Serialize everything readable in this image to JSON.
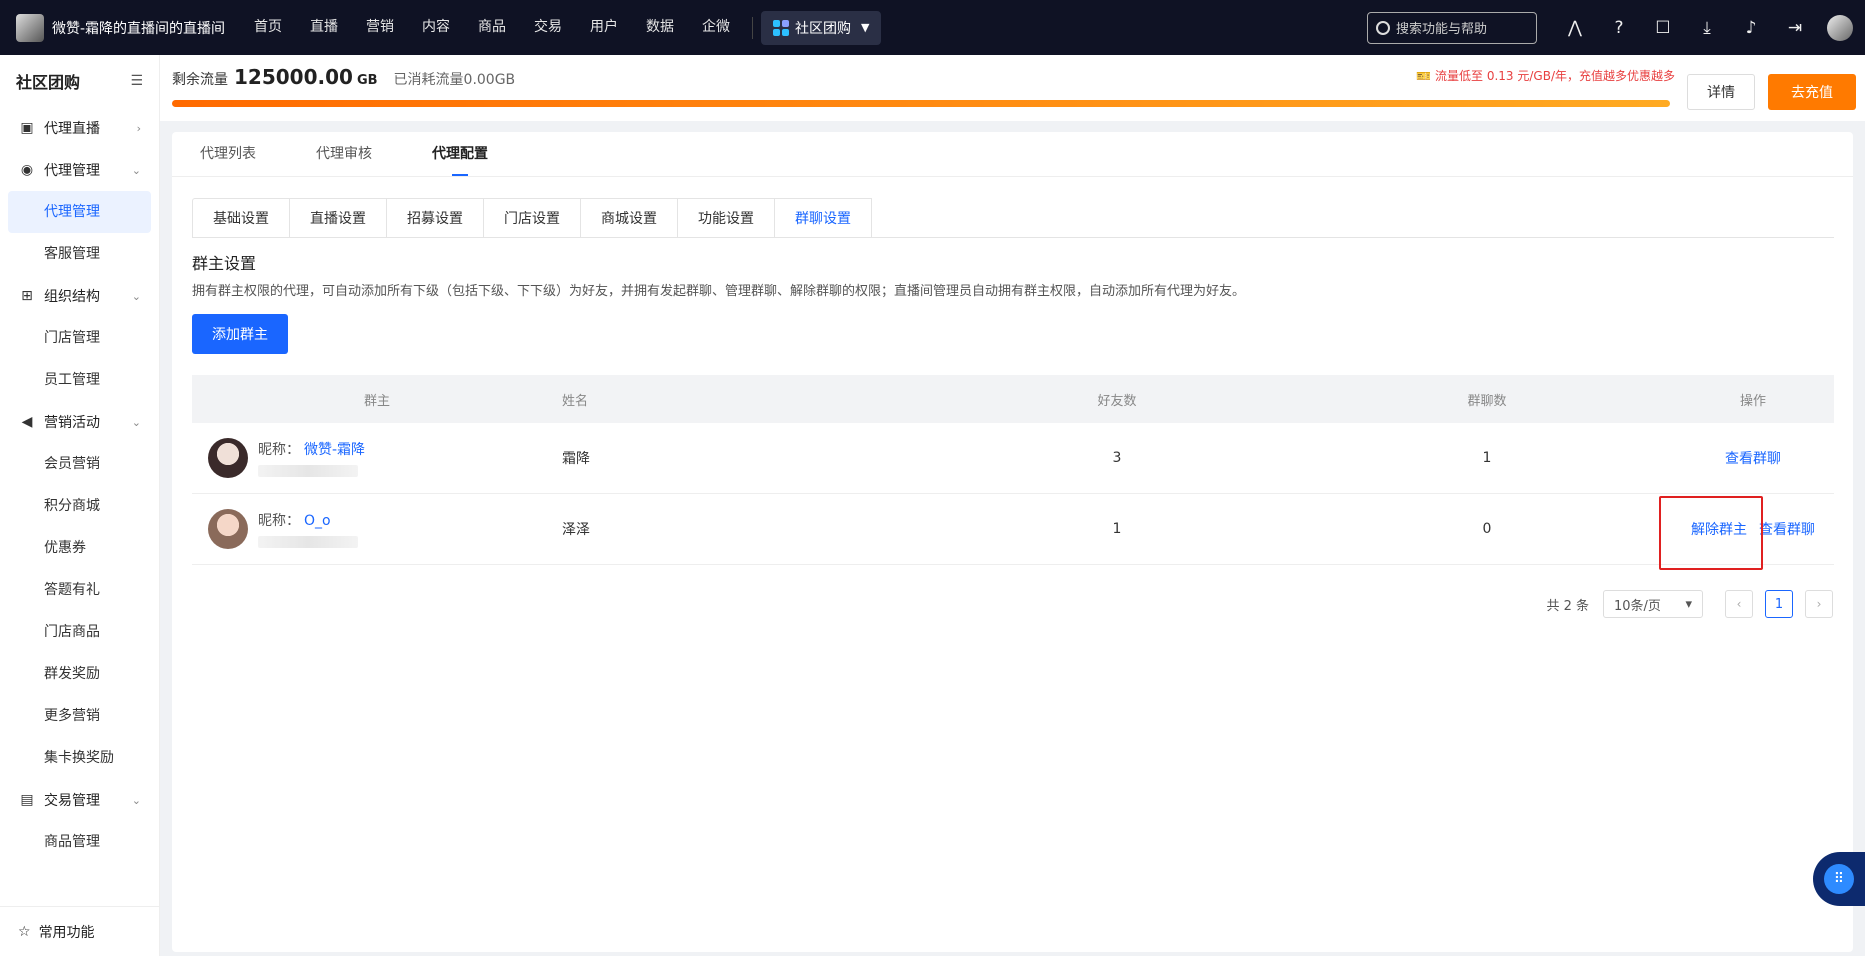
{
  "topbar": {
    "brand_title": "微赞-霜降的直播间的直播间",
    "nav": [
      "首页",
      "直播",
      "营销",
      "内容",
      "商品",
      "交易",
      "用户",
      "数据",
      "企微"
    ],
    "app_switch": "社区团购",
    "search_placeholder": "搜索功能与帮助"
  },
  "sidebar": {
    "title": "社区团购",
    "groups": [
      {
        "label": "代理直播",
        "icon": "live-icon"
      },
      {
        "label": "代理管理",
        "icon": "agent-icon",
        "items": [
          "代理管理",
          "客服管理"
        ]
      },
      {
        "label": "组织结构",
        "icon": "org-icon",
        "items": [
          "门店管理",
          "员工管理"
        ]
      },
      {
        "label": "营销活动",
        "icon": "megaphone-icon",
        "items": [
          "会员营销",
          "积分商城",
          "优惠券",
          "答题有礼",
          "门店商品",
          "群发奖励",
          "更多营销",
          "集卡换奖励"
        ]
      },
      {
        "label": "交易管理",
        "icon": "wallet-icon",
        "items": [
          "商品管理"
        ]
      }
    ],
    "bottom": "常用功能"
  },
  "traffic": {
    "label": "剩余流量",
    "value": "125000.00",
    "unit": "GB",
    "used": "已消耗流量0.00GB",
    "promo": "流量低至 0.13 元/GB/年，充值越多优惠越多",
    "fill_percent": 100,
    "detail_button": "详情",
    "charge_button": "去充值"
  },
  "main": {
    "tabs": [
      "代理列表",
      "代理审核",
      "代理配置"
    ],
    "active_tab": 2,
    "subtabs": [
      "基础设置",
      "直播设置",
      "招募设置",
      "门店设置",
      "商城设置",
      "功能设置",
      "群聊设置"
    ],
    "active_subtab": 6,
    "section_title": "群主设置",
    "section_desc": "拥有群主权限的代理，可自动添加所有下级（包括下级、下下级）为好友，并拥有发起群聊、管理群聊、解除群聊的权限；直播间管理员自动拥有群主权限，自动添加所有代理为好友。",
    "add_button": "添加群主",
    "table": {
      "headers": [
        "群主",
        "姓名",
        "好友数",
        "群聊数",
        "操作"
      ],
      "rows": [
        {
          "nick_label": "昵称：",
          "nick": "微赞-霜降",
          "name": "霜降",
          "friends": "3",
          "groups": "1",
          "actions": [
            "查看群聊"
          ]
        },
        {
          "nick_label": "昵称：",
          "nick": "O_o",
          "name": "泽泽",
          "friends": "1",
          "groups": "0",
          "actions": [
            "解除群主",
            "查看群聊"
          ]
        }
      ]
    },
    "pager": {
      "total": "共 2 条",
      "page_size": "10条/页",
      "current": "1"
    }
  }
}
